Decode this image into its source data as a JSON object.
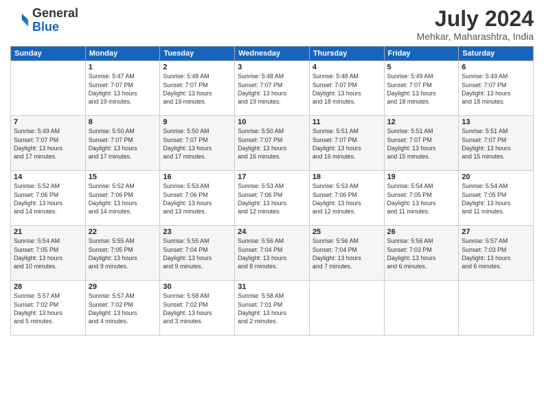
{
  "logo": {
    "line1": "General",
    "line2": "Blue"
  },
  "title": "July 2024",
  "location": "Mehkar, Maharashtra, India",
  "weekdays": [
    "Sunday",
    "Monday",
    "Tuesday",
    "Wednesday",
    "Thursday",
    "Friday",
    "Saturday"
  ],
  "weeks": [
    [
      {
        "day": "",
        "info": ""
      },
      {
        "day": "1",
        "info": "Sunrise: 5:47 AM\nSunset: 7:07 PM\nDaylight: 13 hours\nand 19 minutes."
      },
      {
        "day": "2",
        "info": "Sunrise: 5:48 AM\nSunset: 7:07 PM\nDaylight: 13 hours\nand 19 minutes."
      },
      {
        "day": "3",
        "info": "Sunrise: 5:48 AM\nSunset: 7:07 PM\nDaylight: 13 hours\nand 19 minutes."
      },
      {
        "day": "4",
        "info": "Sunrise: 5:48 AM\nSunset: 7:07 PM\nDaylight: 13 hours\nand 18 minutes."
      },
      {
        "day": "5",
        "info": "Sunrise: 5:49 AM\nSunset: 7:07 PM\nDaylight: 13 hours\nand 18 minutes."
      },
      {
        "day": "6",
        "info": "Sunrise: 5:49 AM\nSunset: 7:07 PM\nDaylight: 13 hours\nand 18 minutes."
      }
    ],
    [
      {
        "day": "7",
        "info": "Sunrise: 5:49 AM\nSunset: 7:07 PM\nDaylight: 13 hours\nand 17 minutes."
      },
      {
        "day": "8",
        "info": "Sunrise: 5:50 AM\nSunset: 7:07 PM\nDaylight: 13 hours\nand 17 minutes."
      },
      {
        "day": "9",
        "info": "Sunrise: 5:50 AM\nSunset: 7:07 PM\nDaylight: 13 hours\nand 17 minutes."
      },
      {
        "day": "10",
        "info": "Sunrise: 5:50 AM\nSunset: 7:07 PM\nDaylight: 13 hours\nand 16 minutes."
      },
      {
        "day": "11",
        "info": "Sunrise: 5:51 AM\nSunset: 7:07 PM\nDaylight: 13 hours\nand 16 minutes."
      },
      {
        "day": "12",
        "info": "Sunrise: 5:51 AM\nSunset: 7:07 PM\nDaylight: 13 hours\nand 15 minutes."
      },
      {
        "day": "13",
        "info": "Sunrise: 5:51 AM\nSunset: 7:07 PM\nDaylight: 13 hours\nand 15 minutes."
      }
    ],
    [
      {
        "day": "14",
        "info": "Sunrise: 5:52 AM\nSunset: 7:06 PM\nDaylight: 13 hours\nand 14 minutes."
      },
      {
        "day": "15",
        "info": "Sunrise: 5:52 AM\nSunset: 7:06 PM\nDaylight: 13 hours\nand 14 minutes."
      },
      {
        "day": "16",
        "info": "Sunrise: 5:53 AM\nSunset: 7:06 PM\nDaylight: 13 hours\nand 13 minutes."
      },
      {
        "day": "17",
        "info": "Sunrise: 5:53 AM\nSunset: 7:06 PM\nDaylight: 13 hours\nand 12 minutes."
      },
      {
        "day": "18",
        "info": "Sunrise: 5:53 AM\nSunset: 7:06 PM\nDaylight: 13 hours\nand 12 minutes."
      },
      {
        "day": "19",
        "info": "Sunrise: 5:54 AM\nSunset: 7:05 PM\nDaylight: 13 hours\nand 11 minutes."
      },
      {
        "day": "20",
        "info": "Sunrise: 5:54 AM\nSunset: 7:05 PM\nDaylight: 13 hours\nand 11 minutes."
      }
    ],
    [
      {
        "day": "21",
        "info": "Sunrise: 5:54 AM\nSunset: 7:05 PM\nDaylight: 13 hours\nand 10 minutes."
      },
      {
        "day": "22",
        "info": "Sunrise: 5:55 AM\nSunset: 7:05 PM\nDaylight: 13 hours\nand 9 minutes."
      },
      {
        "day": "23",
        "info": "Sunrise: 5:55 AM\nSunset: 7:04 PM\nDaylight: 13 hours\nand 9 minutes."
      },
      {
        "day": "24",
        "info": "Sunrise: 5:56 AM\nSunset: 7:04 PM\nDaylight: 13 hours\nand 8 minutes."
      },
      {
        "day": "25",
        "info": "Sunrise: 5:56 AM\nSunset: 7:04 PM\nDaylight: 13 hours\nand 7 minutes."
      },
      {
        "day": "26",
        "info": "Sunrise: 5:56 AM\nSunset: 7:03 PM\nDaylight: 13 hours\nand 6 minutes."
      },
      {
        "day": "27",
        "info": "Sunrise: 5:57 AM\nSunset: 7:03 PM\nDaylight: 13 hours\nand 6 minutes."
      }
    ],
    [
      {
        "day": "28",
        "info": "Sunrise: 5:57 AM\nSunset: 7:02 PM\nDaylight: 13 hours\nand 5 minutes."
      },
      {
        "day": "29",
        "info": "Sunrise: 5:57 AM\nSunset: 7:02 PM\nDaylight: 13 hours\nand 4 minutes."
      },
      {
        "day": "30",
        "info": "Sunrise: 5:58 AM\nSunset: 7:02 PM\nDaylight: 13 hours\nand 3 minutes."
      },
      {
        "day": "31",
        "info": "Sunrise: 5:58 AM\nSunset: 7:01 PM\nDaylight: 13 hours\nand 2 minutes."
      },
      {
        "day": "",
        "info": ""
      },
      {
        "day": "",
        "info": ""
      },
      {
        "day": "",
        "info": ""
      }
    ]
  ]
}
